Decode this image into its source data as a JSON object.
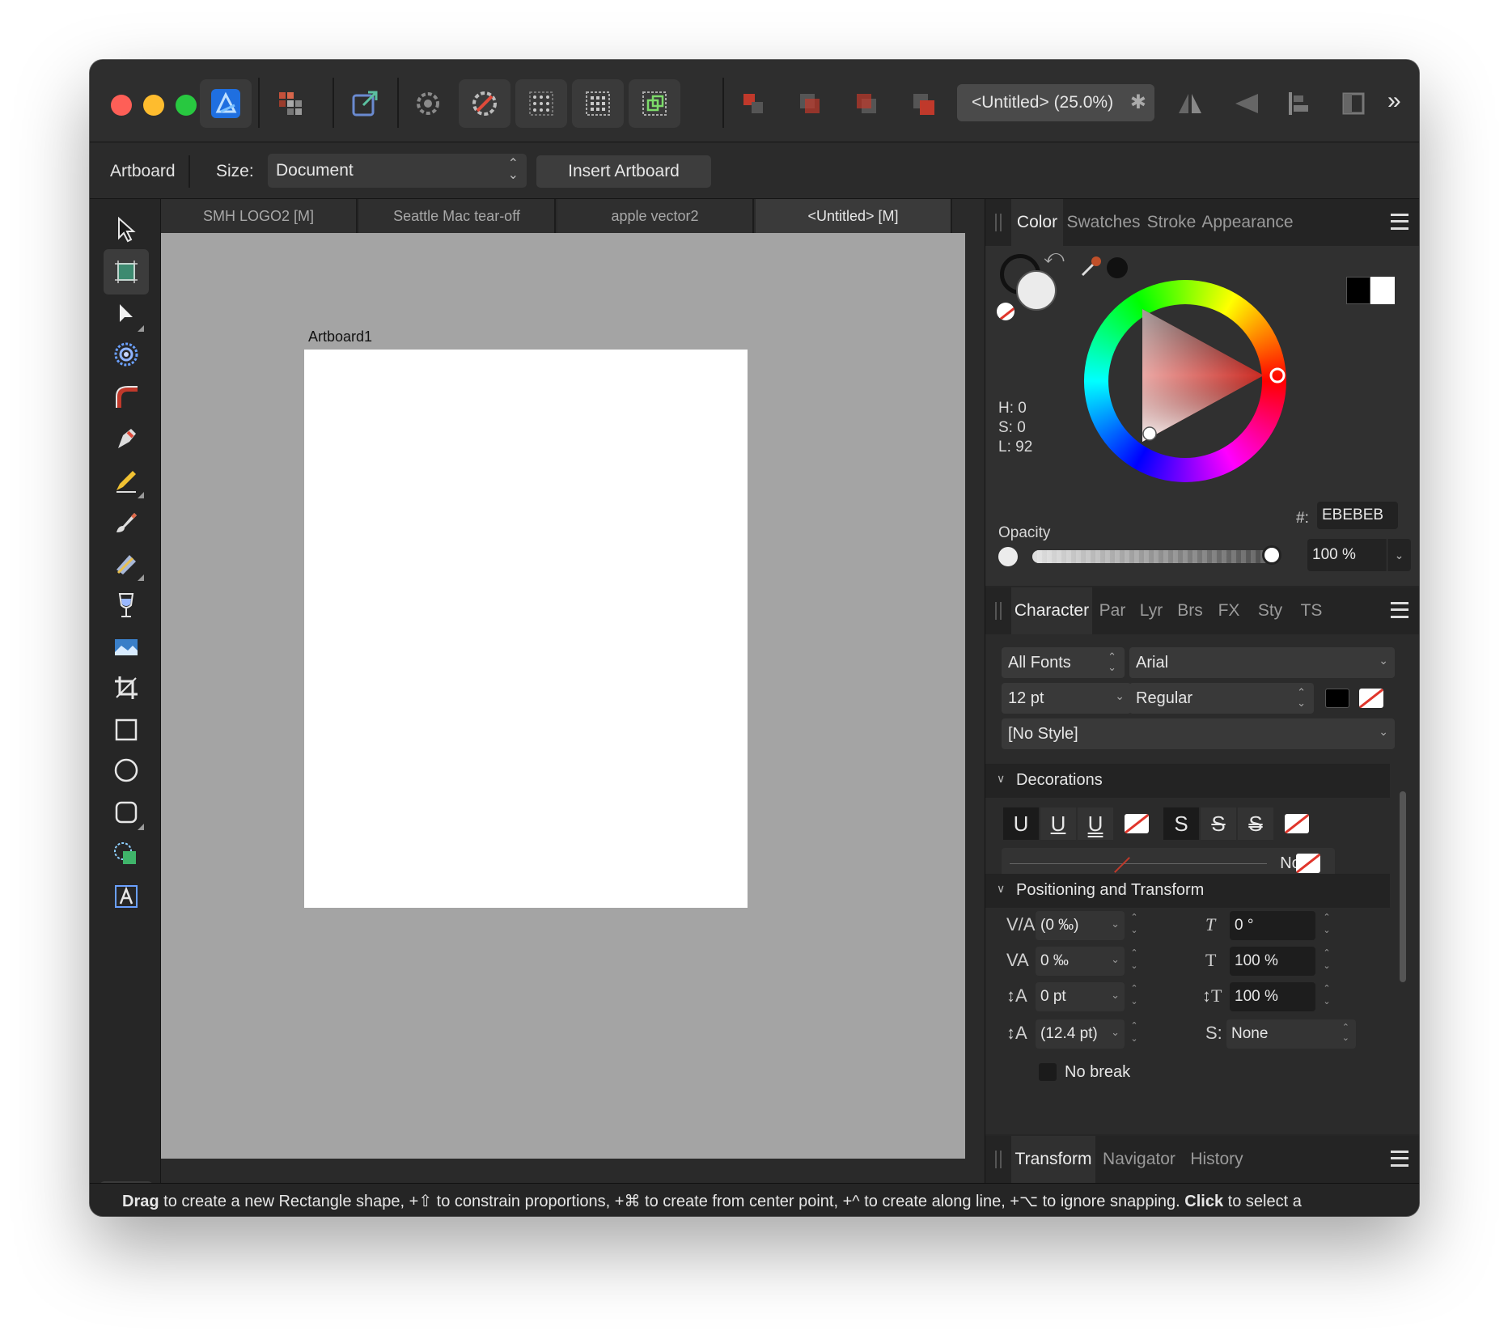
{
  "window": {
    "document_title": "<Untitled> (25.0%)",
    "modified_marker": "✱",
    "overflow_glyph": "»"
  },
  "toolbar_icons": [
    "designer-persona-icon",
    "pixel-persona-icon",
    "export-persona-icon",
    "snapping-settings-icon",
    "snapping-toggle-icon",
    "grid-icon",
    "grid-dense-icon",
    "snap-to-object-icon",
    "arrange-back-icon",
    "arrange-backward-icon",
    "arrange-forward-icon",
    "arrange-front-icon",
    "flip-horizontal-icon",
    "flip-vertical-icon",
    "align-icon",
    "transform-origin-icon"
  ],
  "context": {
    "tool_name": "Artboard",
    "size_label": "Size:",
    "size_value": "Document",
    "insert_button": "Insert Artboard"
  },
  "tools": [
    "move-tool-icon",
    "artboard-tool-icon",
    "node-tool-icon",
    "contour-tool-icon",
    "corner-tool-icon",
    "pen-tool-icon",
    "pencil-tool-icon",
    "vector-brush-icon",
    "fill-tool-icon",
    "transparency-tool-icon",
    "place-image-icon",
    "crop-tool-icon",
    "rectangle-tool-icon",
    "ellipse-tool-icon",
    "rounded-rect-tool-icon",
    "shape-builder-icon",
    "artistic-text-tool-icon"
  ],
  "tools_more": "»",
  "doc_tabs": [
    {
      "label": "SMH LOGO2 [M]"
    },
    {
      "label": "Seattle Mac tear-off"
    },
    {
      "label": "apple vector2"
    },
    {
      "label": "<Untitled> [M]"
    }
  ],
  "canvas": {
    "artboard_label": "Artboard1"
  },
  "color_panel": {
    "tabs": [
      "Color",
      "Swatches",
      "Stroke",
      "Appearance"
    ],
    "h": "H: 0",
    "s": "S: 0",
    "l": "L: 92",
    "hex_label": "#:",
    "hex_value": "EBEBEB",
    "opacity_label": "Opacity",
    "opacity_value": "100 %",
    "opacity_fraction": 1.0,
    "fill_color": "#ebebeb"
  },
  "character_panel": {
    "tabs": [
      "Character",
      "Par",
      "Lyr",
      "Brs",
      "FX",
      "Sty",
      "TS"
    ],
    "font_collection": "All Fonts",
    "font_family": "Arial",
    "font_size": "12 pt",
    "font_style": "Regular",
    "paragraph_style": "[No Style]",
    "decorations_header": "Decorations",
    "decoration_line_value": "None",
    "positioning_header": "Positioning and Transform",
    "kerning": "(0 ‰)",
    "tracking": "0 ‰",
    "baseline": "0 pt",
    "leading": "(12.4 pt)",
    "shear": "0 °",
    "horizontal_scale": "100 %",
    "vertical_scale": "100 %",
    "typography": "None",
    "no_break_label": "No break",
    "decoration_buttons": [
      "U",
      "U",
      "U",
      "S",
      "S",
      "S"
    ]
  },
  "bottom_panel": {
    "tabs": [
      "Transform",
      "Navigator",
      "History"
    ]
  },
  "status": {
    "drag": "Drag",
    "text1": " to create a new Rectangle shape, +⇧ to constrain proportions, +⌘ to create from center point, +^ to create along line, +⌥ to ignore snapping. ",
    "click": "Click",
    "text2": " to select a"
  }
}
